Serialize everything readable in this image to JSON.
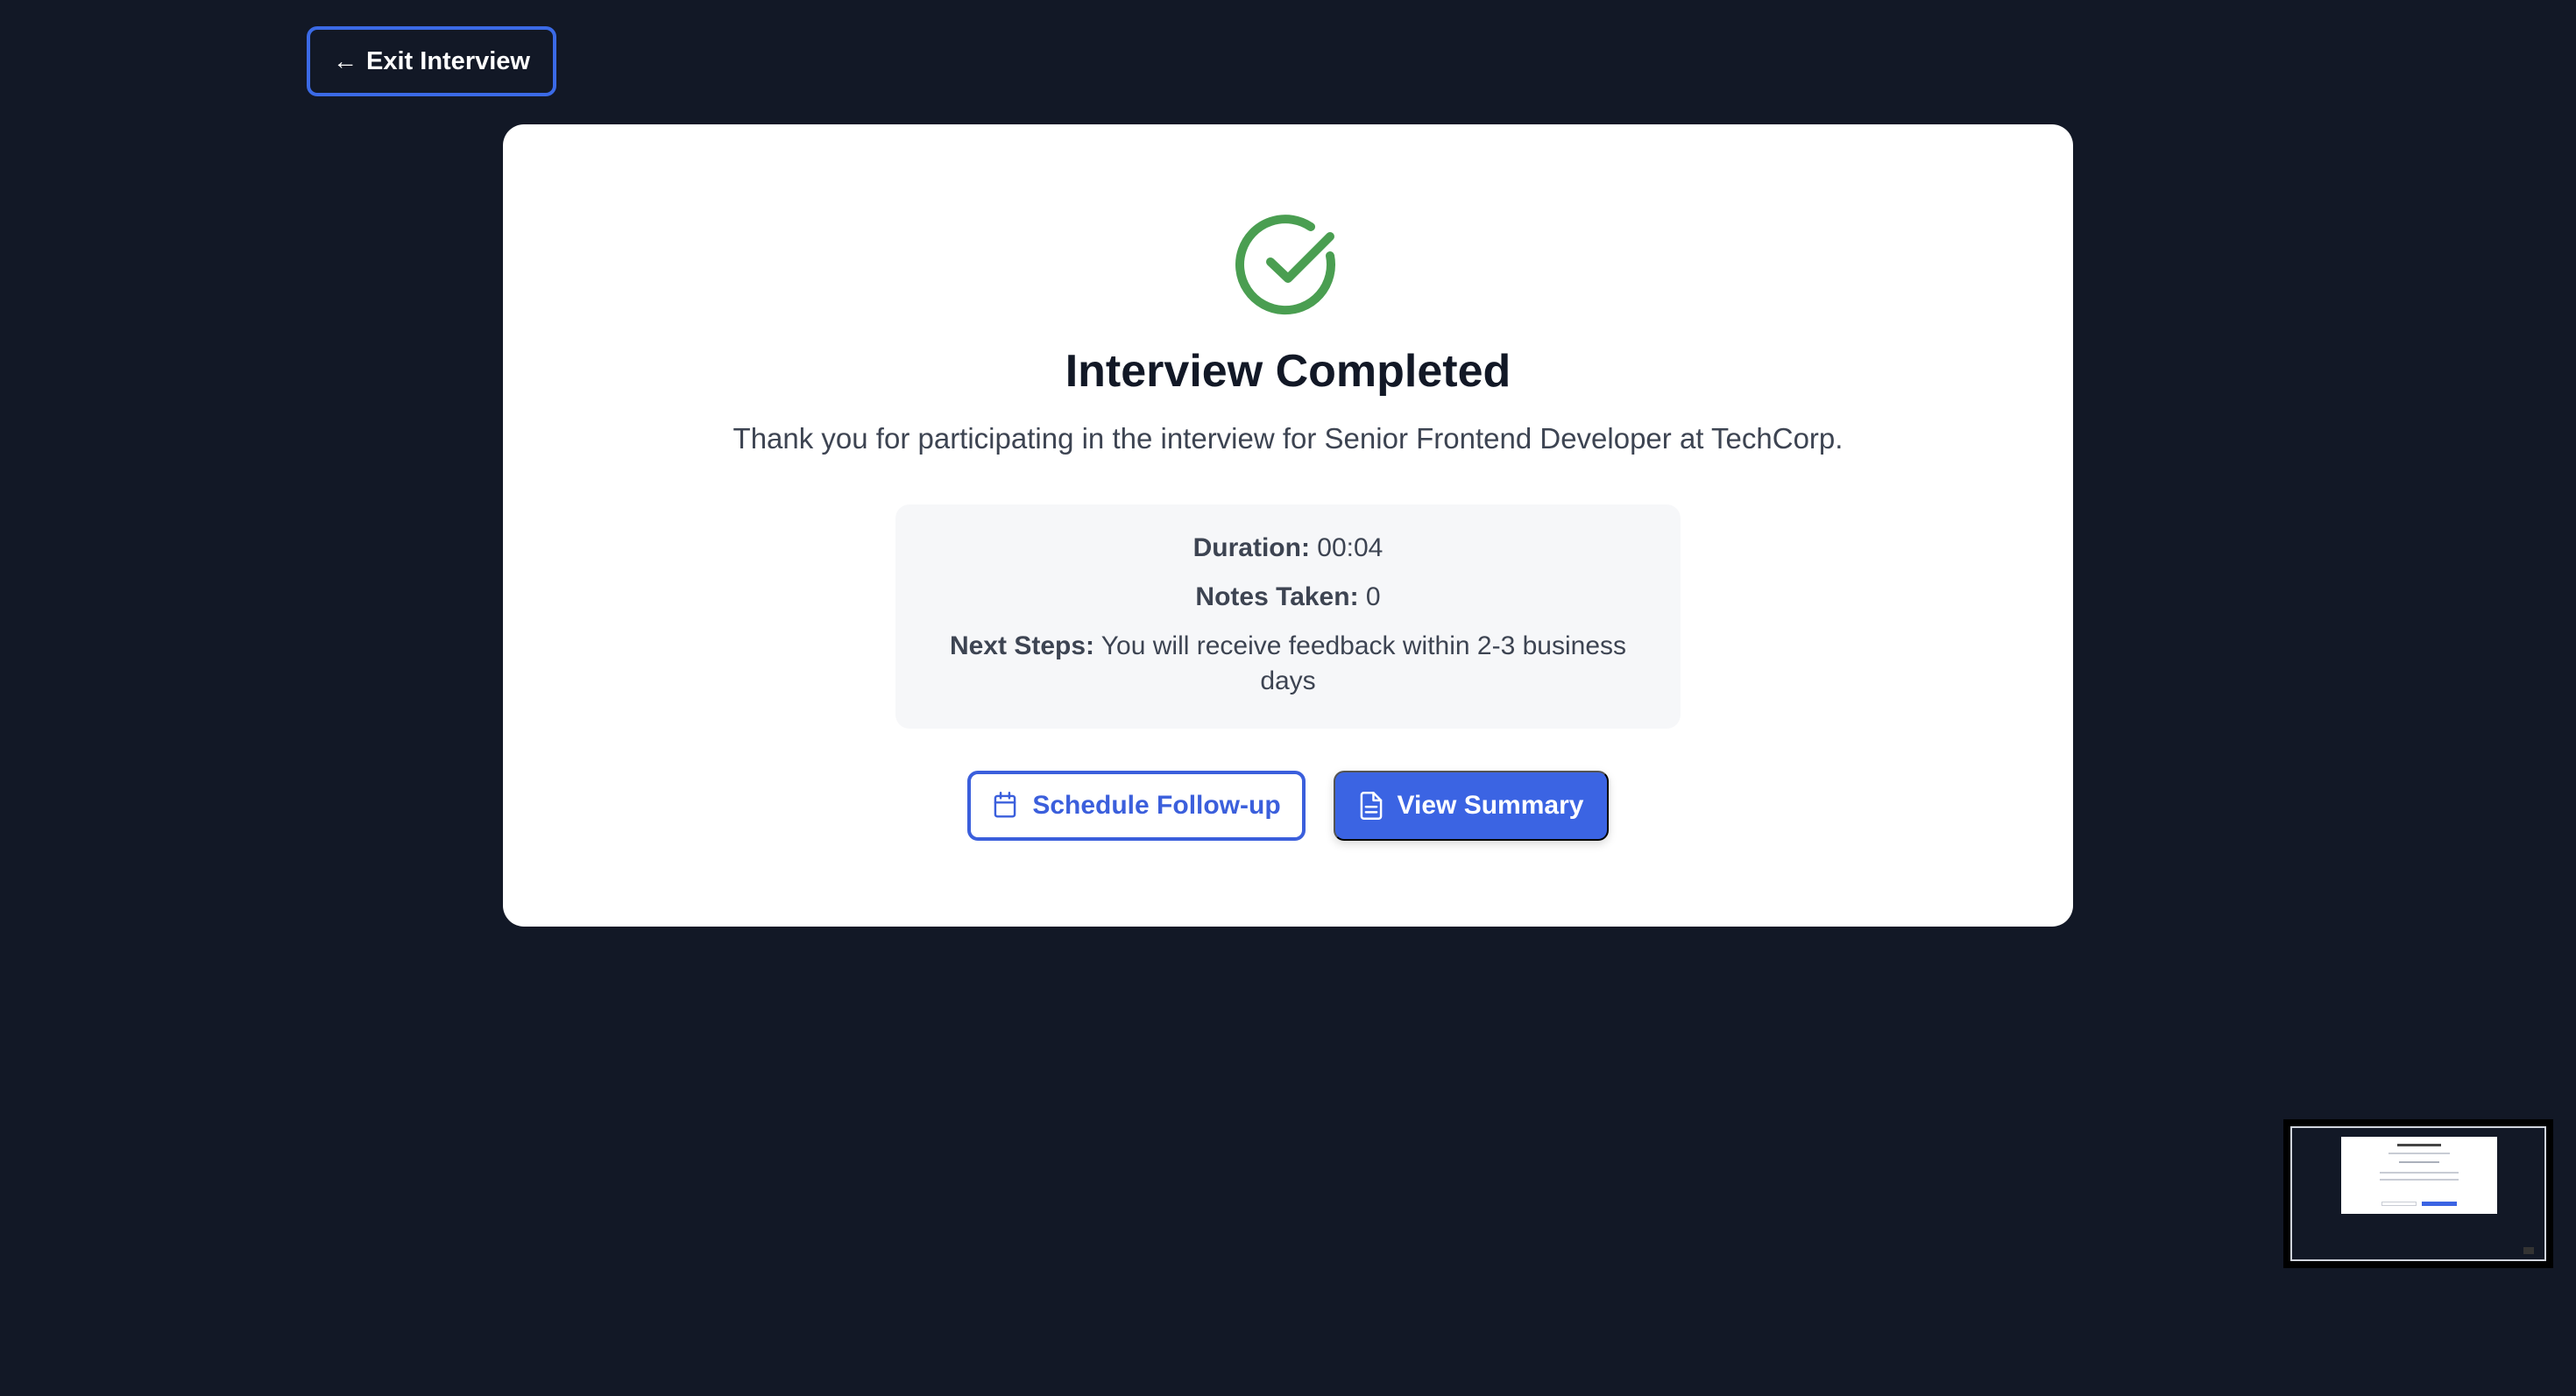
{
  "exit_button": {
    "label": "Exit Interview"
  },
  "completion": {
    "title": "Interview Completed",
    "message": "Thank you for participating in the interview for Senior Frontend Developer at TechCorp."
  },
  "details": {
    "duration_label": "Duration:",
    "duration_value": "00:04",
    "notes_label": "Notes Taken:",
    "notes_value": "0",
    "next_steps_label": "Next Steps:",
    "next_steps_value": "You will receive feedback within 2-3 business days"
  },
  "actions": {
    "followup_label": "Schedule Follow-up",
    "summary_label": "View Summary"
  },
  "colors": {
    "background": "#121826",
    "accent": "#3b64e3",
    "success": "#4a9e51"
  },
  "icons": {
    "exit": "arrow-left-icon",
    "status": "check-circle-icon",
    "followup": "calendar-icon",
    "summary": "document-icon"
  }
}
